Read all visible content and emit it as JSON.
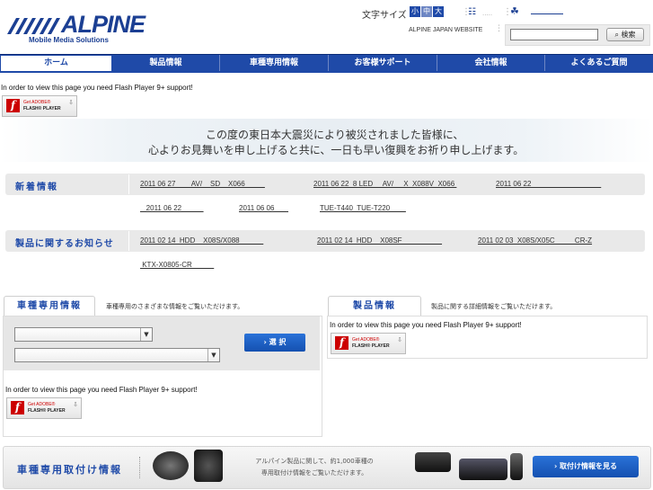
{
  "header": {
    "logo_text": "ALPINE",
    "logo_sub": "Mobile Media Solutions",
    "font_size_label": "文字サイズ",
    "font_sizes": [
      "小",
      "中",
      "大"
    ],
    "site_link": "ALPINE JAPAN WEBSITE",
    "search_placeholder": "",
    "search_button": "検索"
  },
  "nav": {
    "items": [
      "ホーム",
      "製品情報",
      "車種専用情報",
      "お客様サポート",
      "会社情報",
      "よくあるご質問"
    ]
  },
  "flash": {
    "message": "In order to view this page you need Flash Player 9+ support!",
    "badge_line1": "Get ADOBE®",
    "badge_line2": "FLASH® PLAYER"
  },
  "banner": {
    "line1": "この度の東日本大震災により被災されました皆様に、",
    "line2": "心よりお見舞いを申し上げると共に、一日も早い復興をお祈り申し上げます。"
  },
  "news": {
    "title": "新着情報",
    "links_row1": [
      "2011 06 27        AV/    SD    X066          ",
      "2011 06 22  8 LED     AV/     X  X088V  X066 ",
      "2011 06 22                                   "
    ],
    "links_row2": [
      "   2011 06 22           ",
      "2011 06 06       ",
      "TUE-T440  TUE-T220        "
    ]
  },
  "product_news": {
    "title": "製品に関するお知らせ",
    "links_row1": [
      "2011 02 14  HDD    X08S/X088            ",
      "2011 02 14  HDD    X08SF                    ",
      "2011 02 03  X08S/X05C          CR-Z"
    ],
    "links_row2": [
      " KTX-X0805-CR           "
    ]
  },
  "vehicle": {
    "tab": "車種専用情報",
    "desc": "車種専用のさまざまな情報をご覧いただけます。",
    "select1": "",
    "select2": "",
    "button": "選 択"
  },
  "product_info": {
    "tab": "製品情報",
    "desc": "製品に関する詳細情報をご覧いただけます。"
  },
  "bottom": {
    "title": "車種専用取付け情報",
    "text_line1": "アルパイン製品に関して、約1,000車種の",
    "text_line2": "専用取付け情報をご覧いただけます。",
    "button": "取付け情報を見る"
  }
}
